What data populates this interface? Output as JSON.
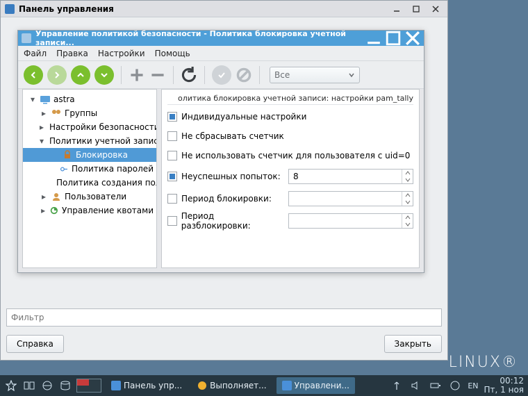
{
  "outer_window": {
    "title": "Панель управления",
    "filter_placeholder": "Фильтр",
    "help_btn": "Справка",
    "close_btn": "Закрыть"
  },
  "inner_window": {
    "title": "Управление политикой безопасности - Политика блокировка учетной записи...",
    "menu": [
      "Файл",
      "Правка",
      "Настройки",
      "Помощь"
    ],
    "combo": "Все"
  },
  "tree": {
    "root": "astra",
    "items": [
      {
        "label": "Группы",
        "icon": "users"
      },
      {
        "label": "Настройки безопасности",
        "icon": "shield"
      },
      {
        "label": "Политики учетной записи",
        "icon": "user",
        "expanded": true,
        "children": [
          {
            "label": "Блокировка",
            "icon": "lock",
            "selected": true
          },
          {
            "label": "Политика паролей",
            "icon": "key"
          },
          {
            "label": "Политика создания пол...",
            "icon": "doc"
          }
        ]
      },
      {
        "label": "Пользователи",
        "icon": "person"
      },
      {
        "label": "Управление квотами",
        "icon": "quota"
      }
    ]
  },
  "detail": {
    "heading": "олитика блокировка учетной записи: настройки pam_tally",
    "checks": [
      {
        "label": "Индивидуальные настройки",
        "checked": true
      },
      {
        "label": "Не сбрасывать счетчик",
        "checked": false
      },
      {
        "label": "Не использовать счетчик для пользователя с uid=0",
        "checked": false
      }
    ],
    "fields": [
      {
        "label": "Неуспешных попыток:",
        "checked": true,
        "value": "8"
      },
      {
        "label": "Период блокировки:",
        "checked": false,
        "value": ""
      },
      {
        "label": "Период разблокировки:",
        "checked": false,
        "value": ""
      }
    ]
  },
  "taskbar": {
    "tasks": [
      {
        "label": "Панель упр...",
        "icon": "#4a90d9",
        "active": false
      },
      {
        "label": "Выполняет...",
        "icon": "#f0b030",
        "active": false
      },
      {
        "label": "Управлени...",
        "icon": "#4a90d9",
        "active": true
      }
    ],
    "lang": "EN",
    "time": "00:12",
    "date": "Пт, 1 ноя"
  },
  "watermark": "LINUX®"
}
